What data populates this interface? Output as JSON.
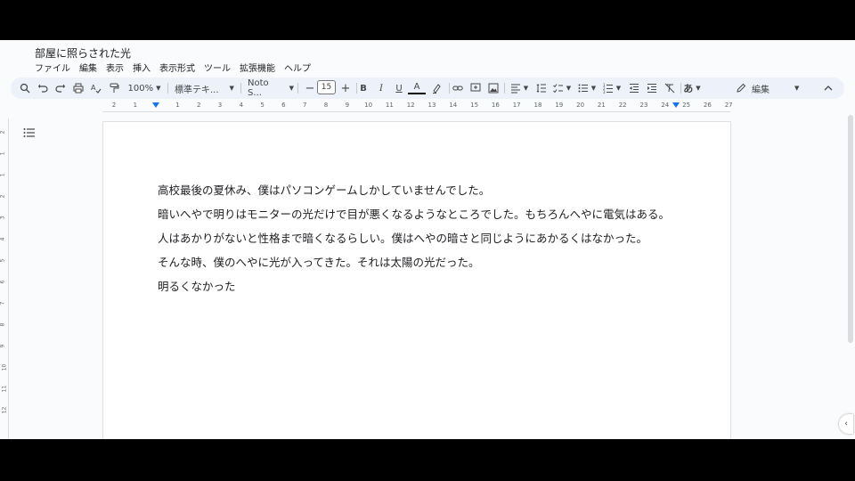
{
  "document": {
    "title": "部屋に照らされた光",
    "lines": [
      "高校最後の夏休み、僕はパソコンゲームしかしていませんでした。",
      "暗いへやで明りはモニターの光だけで目が悪くなるようなところでした。もちろんへやに電気はある。",
      "人はあかりがないと性格まで暗くなるらしい。僕はへやの暗さと同じようにあかるくはなかった。",
      "そんな時、僕のへやに光が入ってきた。それは太陽の光だった。",
      "明るくなかった"
    ]
  },
  "menu": [
    "ファイル",
    "編集",
    "表示",
    "挿入",
    "表示形式",
    "ツール",
    "拡張機能",
    "ヘルプ"
  ],
  "toolbar": {
    "zoom": "100%",
    "style": "標準テキ...",
    "font": "Noto S...",
    "font_size": "15",
    "minus": "−",
    "plus": "+",
    "bold": "B",
    "italic": "I",
    "underline": "U",
    "text_color": "A",
    "input_tool": "あ",
    "mode": "編集"
  },
  "ruler": {
    "ticks": [
      "2",
      "1",
      "",
      "1",
      "2",
      "3",
      "4",
      "5",
      "6",
      "7",
      "8",
      "9",
      "10",
      "11",
      "12",
      "13",
      "14",
      "15",
      "16",
      "17",
      "18",
      "19",
      "20",
      "21",
      "22",
      "23",
      "24",
      "25",
      "26",
      "27"
    ]
  },
  "vruler": [
    "2",
    "1",
    "1",
    "2",
    "3",
    "4",
    "5",
    "6",
    "7",
    "8",
    "9",
    "10",
    "11",
    "12"
  ],
  "colors": {
    "accent": "#1a73e8",
    "toolbar_bg": "#edf2fa",
    "canvas_bg": "#f9fbfd"
  }
}
